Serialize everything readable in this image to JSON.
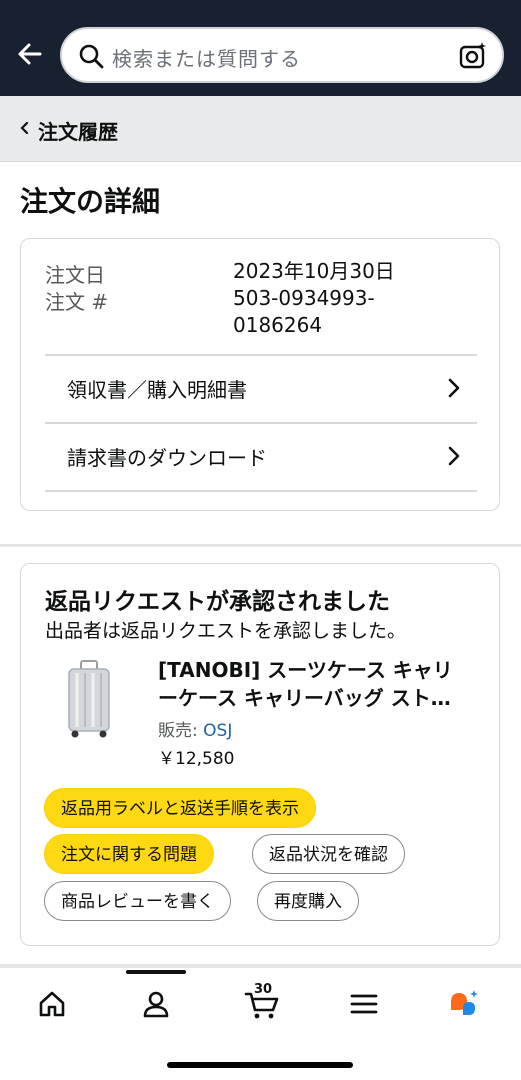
{
  "header": {
    "search_placeholder": "検索または質問する"
  },
  "breadcrumb": {
    "label": "注文履歴"
  },
  "page": {
    "title": "注文の詳細"
  },
  "order": {
    "date_label": "注文日",
    "date_value": "2023年10月30日",
    "number_label": "注文 #",
    "number_line1": "503-0934993-",
    "number_line2": "0186264",
    "links": [
      {
        "label": "領収書／購入明細書"
      },
      {
        "label": "請求書のダウンロード"
      }
    ]
  },
  "return": {
    "heading": "返品リクエストが承認されました",
    "message": "出品者は返品リクエストを承認しました。",
    "product_line1": "[TANOBI] スーツケース キャリ",
    "product_line2": "ーケース キャリーバッグ スト…",
    "seller_prefix": "販売: ",
    "seller_name": "OSJ",
    "price": "￥12,580",
    "buttons": {
      "label_button": "返品用ラベルと返送手順を表示",
      "problem_button": "注文に関する問題",
      "status_button": "返品状況を確認",
      "review_button": "商品レビューを書く",
      "rebuy_button": "再度購入"
    }
  },
  "bottom_nav": {
    "cart_count": "30",
    "items": [
      "home-icon",
      "account-icon",
      "cart-icon",
      "menu-icon",
      "rufus-assistant-icon"
    ]
  },
  "colors": {
    "header_bg": "#18212f",
    "button_yellow": "#ffd814",
    "link_blue": "#2162a1"
  }
}
